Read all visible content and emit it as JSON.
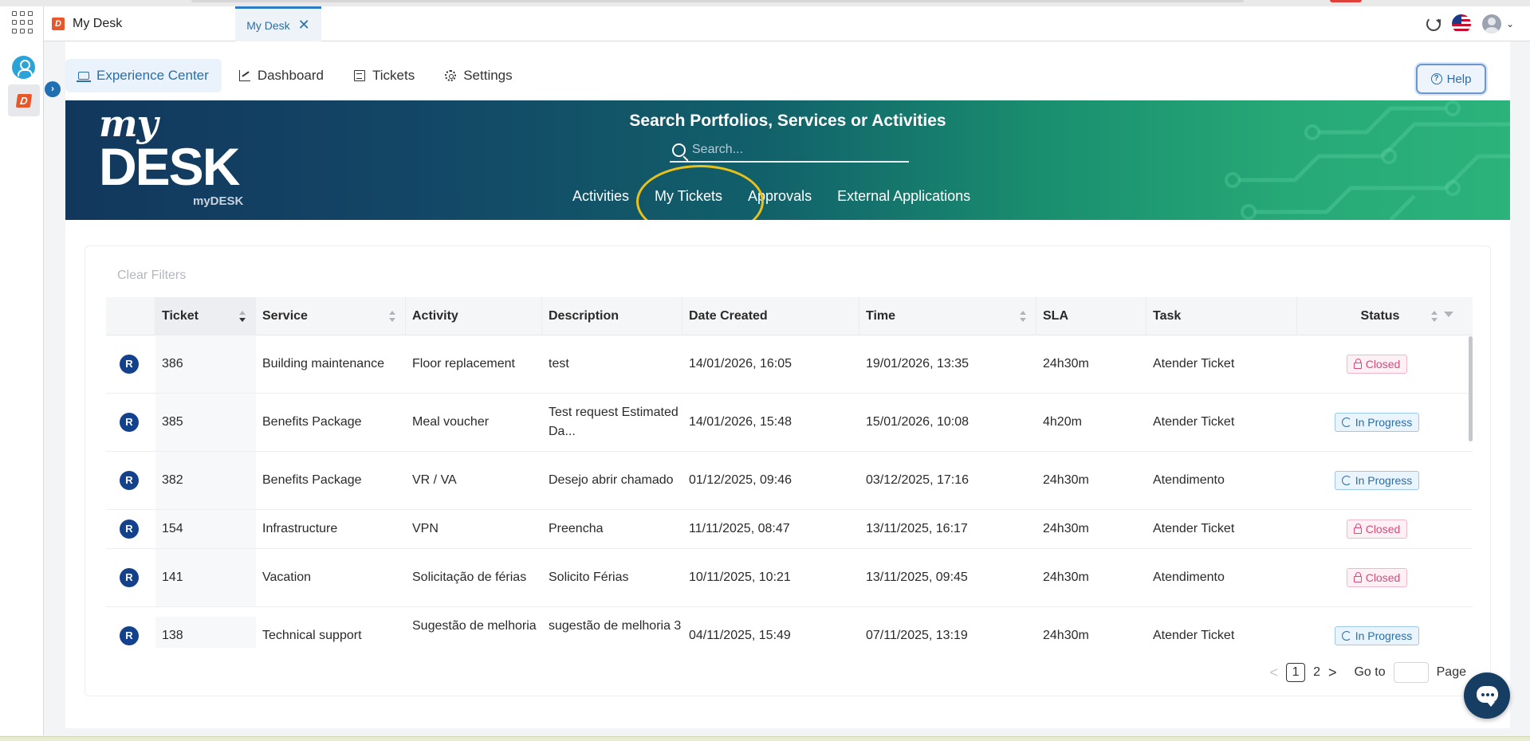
{
  "window": {
    "app_title": "My Desk",
    "tab_label": "My Desk",
    "tab_close": "✕"
  },
  "nav": {
    "items": [
      {
        "label": "Experience Center",
        "icon": "laptop-icon",
        "active": true
      },
      {
        "label": "Dashboard",
        "icon": "chart-icon",
        "active": false
      },
      {
        "label": "Tickets",
        "icon": "list-icon",
        "active": false
      },
      {
        "label": "Settings",
        "icon": "gear-icon",
        "active": false
      }
    ],
    "help_label": "Help"
  },
  "banner": {
    "brand_my": "my",
    "brand_desk": "DESK",
    "brand_sub": "myDESK",
    "search_title": "Search Portfolios, Services or Activities",
    "search_placeholder": "Search...",
    "links": [
      "Activities",
      "My Tickets",
      "Approvals",
      "External Applications"
    ],
    "highlighted_link": "My Tickets",
    "highlight_color": "#e8c21b"
  },
  "table": {
    "clear_filters": "Clear Filters",
    "columns": [
      "Ticket",
      "Service",
      "Activity",
      "Description",
      "Date Created",
      "Time",
      "SLA",
      "Task",
      "Status"
    ],
    "rows": [
      {
        "type": "R",
        "ticket": "386",
        "service": "Building maintenance",
        "activity": "Floor replacement",
        "description": "test",
        "date_created": "14/01/2026, 16:05",
        "time": "19/01/2026, 13:35",
        "sla": "24h30m",
        "task": "Atender Ticket",
        "status": "Closed"
      },
      {
        "type": "R",
        "ticket": "385",
        "service": "Benefits Package",
        "activity": "Meal voucher",
        "description": "Test request Estimated Da...",
        "date_created": "14/01/2026, 15:48",
        "time": "15/01/2026, 10:08",
        "sla": "4h20m",
        "task": "Atender Ticket",
        "status": "In Progress"
      },
      {
        "type": "R",
        "ticket": "382",
        "service": "Benefits Package",
        "activity": "VR / VA",
        "description": "Desejo abrir chamado",
        "date_created": "01/12/2025, 09:46",
        "time": "03/12/2025, 17:16",
        "sla": "24h30m",
        "task": "Atendimento",
        "status": "In Progress"
      },
      {
        "type": "R",
        "ticket": "154",
        "service": "Infrastructure",
        "activity": "VPN",
        "description": "Preencha",
        "date_created": "11/11/2025, 08:47",
        "time": "13/11/2025, 16:17",
        "sla": "24h30m",
        "task": "Atender Ticket",
        "status": "Closed"
      },
      {
        "type": "R",
        "ticket": "141",
        "service": "Vacation",
        "activity": "Solicitação de férias",
        "description": "Solicito Férias",
        "date_created": "10/11/2025, 10:21",
        "time": "13/11/2025, 09:45",
        "sla": "24h30m",
        "task": "Atendimento",
        "status": "Closed"
      },
      {
        "type": "R",
        "ticket": "138",
        "service": "Technical support",
        "activity": "Sugestão de melhoria",
        "description": "sugestão de melhoria 3",
        "date_created": "04/11/2025, 15:49",
        "time": "07/11/2025, 13:19",
        "sla": "24h30m",
        "task": "Atender Ticket",
        "status": "In Progress"
      }
    ]
  },
  "pagination": {
    "prev": "<",
    "pages": [
      "1",
      "2"
    ],
    "current": "1",
    "next": ">",
    "goto_label": "Go to",
    "page_label": "Page"
  },
  "colors": {
    "accent": "#2b6ea8",
    "closed": "#d64a7c",
    "in_progress": "#2b6ea8",
    "badge": "#14418b"
  }
}
